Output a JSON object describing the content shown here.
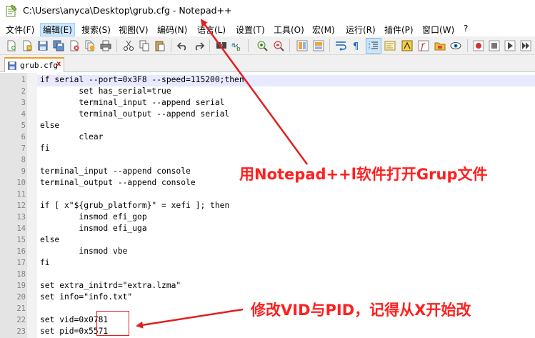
{
  "window": {
    "title": "C:\\Users\\anyca\\Desktop\\grub.cfg - Notepad++"
  },
  "menu": [
    {
      "label": "文件(F)",
      "name": "menu-file"
    },
    {
      "label": "编辑(E)",
      "name": "menu-edit"
    },
    {
      "label": "搜索(S)",
      "name": "menu-search"
    },
    {
      "label": "视图(V)",
      "name": "menu-view"
    },
    {
      "label": "编码(N)",
      "name": "menu-encoding"
    },
    {
      "label": "语言(L)",
      "name": "menu-language"
    },
    {
      "label": "设置(T)",
      "name": "menu-settings"
    },
    {
      "label": "工具(O)",
      "name": "menu-tools"
    },
    {
      "label": "宏(M)",
      "name": "menu-macro"
    },
    {
      "label": "运行(R)",
      "name": "menu-run"
    },
    {
      "label": "插件(P)",
      "name": "menu-plugins"
    },
    {
      "label": "窗口(W)",
      "name": "menu-window"
    },
    {
      "label": "?",
      "name": "menu-help"
    }
  ],
  "toolbar_icons": [
    "new-file-icon",
    "open-file-icon",
    "save-icon",
    "save-all-icon",
    "close-icon",
    "close-all-icon",
    "print-icon",
    "cut-icon",
    "copy-icon",
    "paste-icon",
    "undo-icon",
    "redo-icon",
    "find-icon",
    "replace-icon",
    "zoom-in-icon",
    "zoom-out-icon",
    "sync-vertical-icon",
    "sync-horizontal-icon",
    "word-wrap-icon",
    "show-all-chars-icon",
    "indent-guide-icon",
    "user-language-icon",
    "doc-map-icon",
    "function-list-icon",
    "folder-workspace-icon",
    "monitoring-icon",
    "record-macro-icon",
    "stop-macro-icon",
    "play-macro-icon",
    "run-macro-multiple-icon",
    "save-macro-icon"
  ],
  "tab": {
    "label": "grub.cfg",
    "close": "x"
  },
  "editor": {
    "lines": [
      {
        "n": "1",
        "text": "if serial --port=0x3F8 --speed=115200;then"
      },
      {
        "n": "2",
        "text": "        set has_serial=true"
      },
      {
        "n": "3",
        "text": "        terminal_input --append serial"
      },
      {
        "n": "4",
        "text": "        terminal_output --append serial"
      },
      {
        "n": "5",
        "text": "else"
      },
      {
        "n": "6",
        "text": "        clear"
      },
      {
        "n": "7",
        "text": "fi"
      },
      {
        "n": "8",
        "text": ""
      },
      {
        "n": "9",
        "text": "terminal_input --append console"
      },
      {
        "n": "10",
        "text": "terminal_output --append console"
      },
      {
        "n": "11",
        "text": ""
      },
      {
        "n": "12",
        "text": "if [ x\"${grub_platform}\" = xefi ]; then"
      },
      {
        "n": "13",
        "text": "        insmod efi_gop"
      },
      {
        "n": "14",
        "text": "        insmod efi_uga"
      },
      {
        "n": "15",
        "text": "else"
      },
      {
        "n": "16",
        "text": "        insmod vbe"
      },
      {
        "n": "17",
        "text": "fi"
      },
      {
        "n": "18",
        "text": ""
      },
      {
        "n": "19",
        "text": "set extra_initrd=\"extra.lzma\""
      },
      {
        "n": "20",
        "text": "set info=\"info.txt\""
      },
      {
        "n": "21",
        "text": ""
      },
      {
        "n": "22",
        "text": "set vid=0x0781"
      },
      {
        "n": "23",
        "text": "set pid=0x5571"
      }
    ]
  },
  "annotations": {
    "open_note": "用Notepad++l软件打开Grup文件",
    "edit_note": "修改VID与PID，记得从X开始改"
  },
  "colors": {
    "annotation_red": "#ff2020",
    "current_line": "#e8e8ff",
    "tab_accent": "#f59b1a"
  }
}
